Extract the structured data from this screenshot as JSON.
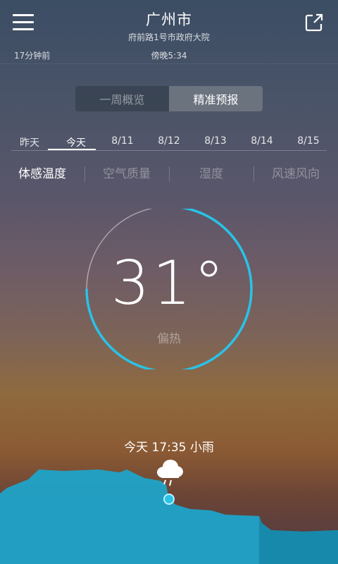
{
  "header": {
    "city": "广州市",
    "address": "府前路1号市政府大院",
    "updated_ago": "17分钟前",
    "publish_time": "傍晚5:34",
    "menu_icon": "menu-icon",
    "share_icon": "share-icon"
  },
  "segment": {
    "tabs": [
      {
        "label": "一周概览",
        "active": false
      },
      {
        "label": "精准预报",
        "active": true
      }
    ]
  },
  "days": [
    "昨天",
    "今天",
    "8/11",
    "8/12",
    "8/13",
    "8/14",
    "8/15"
  ],
  "active_day": "今天",
  "metrics": [
    "体感温度",
    "空气质量",
    "湿度",
    "风速风向"
  ],
  "active_metric": "体感温度",
  "dial": {
    "temperature": "31°",
    "description": "偏热",
    "fill_fraction": 0.75,
    "color": "#29c3e8"
  },
  "forecast": {
    "text": "今天 17:35 小雨",
    "icon": "cloud-rain-icon",
    "area_color": "#1fa3c9"
  }
}
